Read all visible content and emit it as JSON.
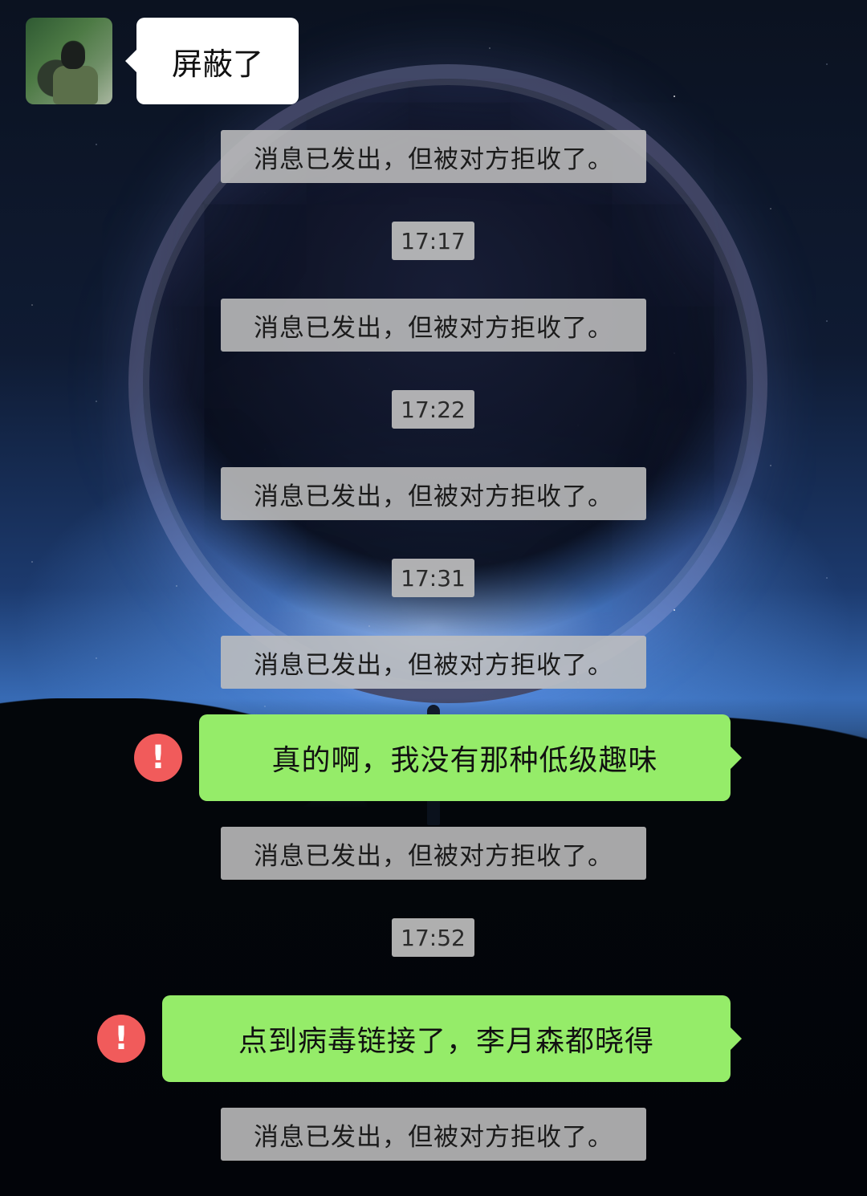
{
  "incoming": {
    "text": "屏蔽了"
  },
  "messages": {
    "rejected_notice": "消息已发出，但被对方拒收了。",
    "times": [
      "17:17",
      "17:22",
      "17:31",
      "17:52"
    ],
    "outgoing": [
      "真的啊，我没有那种低级趣味",
      "点到病毒链接了，李月森都晓得"
    ],
    "error_symbol": "!"
  },
  "colors": {
    "outgoing_bubble": "#95ec69",
    "incoming_bubble": "#ffffff",
    "system_notice": "#bebebe",
    "error_badge": "#f15b5b"
  },
  "icons": {
    "error": "exclamation-circle-icon"
  }
}
